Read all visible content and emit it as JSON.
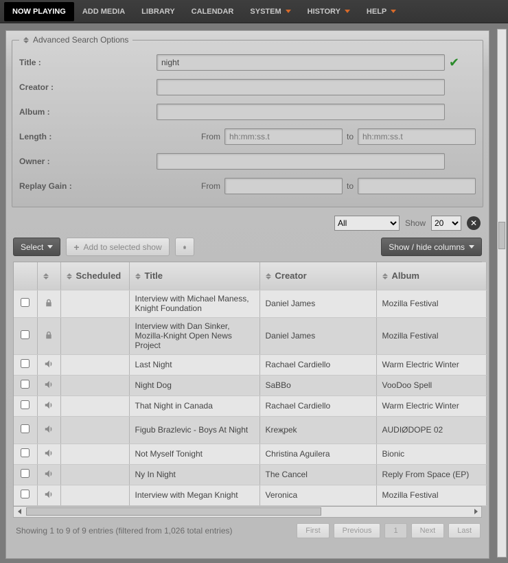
{
  "nav": {
    "now_playing": "NOW PLAYING",
    "add_media": "ADD MEDIA",
    "library": "LIBRARY",
    "calendar": "CALENDAR",
    "system": "SYSTEM",
    "history": "HISTORY",
    "help": "HELP"
  },
  "search": {
    "legend": "Advanced Search Options",
    "title_label": "Title :",
    "title_value": "night",
    "creator_label": "Creator :",
    "creator_value": "",
    "album_label": "Album :",
    "album_value": "",
    "length_label": "Length :",
    "length_from_label": "From",
    "length_to_label": "to",
    "length_placeholder": "hh:mm:ss.t",
    "owner_label": "Owner :",
    "owner_value": "",
    "replay_label": "Replay Gain :",
    "replay_from_label": "From",
    "replay_to_label": "to"
  },
  "bar": {
    "filter_all": "All",
    "show_label": "Show",
    "show_value": "20",
    "select_label": "Select",
    "add_label": "Add to selected show",
    "showhide_label": "Show / hide columns"
  },
  "columns": {
    "scheduled": "Scheduled",
    "title": "Title",
    "creator": "Creator",
    "album": "Album"
  },
  "rows": [
    {
      "locked": true,
      "title": "Interview with Michael Maness, Knight Foundation",
      "creator": "Daniel James",
      "album": "Mozilla Festival",
      "height": "med"
    },
    {
      "locked": true,
      "title": "Interview with Dan Sinker, Mozilla-Knight Open News Project",
      "creator": "Daniel James",
      "album": "Mozilla Festival",
      "height": "tall"
    },
    {
      "locked": false,
      "title": "Last Night",
      "creator": "Rachael Cardiello",
      "album": "Warm Electric Winter",
      "height": ""
    },
    {
      "locked": false,
      "title": "Night Dog",
      "creator": "SaBBo",
      "album": "VooDoo Spell",
      "height": ""
    },
    {
      "locked": false,
      "title": "That Night in Canada",
      "creator": "Rachael Cardiello",
      "album": "Warm Electric Winter",
      "height": ""
    },
    {
      "locked": false,
      "title": "Figub Brazlevic - Boys At Night",
      "creator": "Kreҗpek",
      "album": "AUDIØDOPE 02",
      "height": "med"
    },
    {
      "locked": false,
      "title": "Not Myself Tonight",
      "creator": "Christina Aguilera",
      "album": "Bionic",
      "height": ""
    },
    {
      "locked": false,
      "title": "Ny In Night",
      "creator": "The Cancel",
      "album": "Reply From Space (EP)",
      "height": ""
    },
    {
      "locked": false,
      "title": "Interview with Megan Knight",
      "creator": "Veronica",
      "album": "Mozilla Festival",
      "height": ""
    }
  ],
  "footer": {
    "info": "Showing 1 to 9 of 9 entries (filtered from 1,026 total entries)",
    "first": "First",
    "prev": "Previous",
    "page": "1",
    "next": "Next",
    "last": "Last"
  }
}
